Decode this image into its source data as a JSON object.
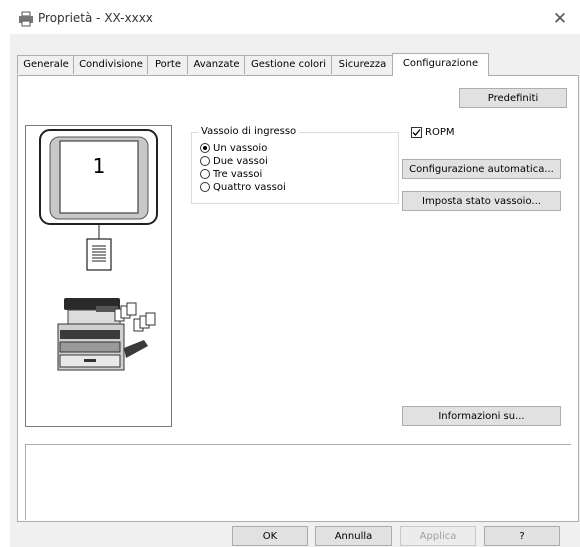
{
  "window": {
    "title": "Proprietà - XX-xxxx"
  },
  "tabs": [
    {
      "label": "Generale"
    },
    {
      "label": "Condivisione"
    },
    {
      "label": "Porte"
    },
    {
      "label": "Avanzate"
    },
    {
      "label": "Gestione colori"
    },
    {
      "label": "Sicurezza"
    },
    {
      "label": "Configurazione",
      "active": true
    }
  ],
  "config": {
    "defaults_label": "Predefiniti",
    "preview": {
      "tray_number": "1"
    },
    "tray_group": {
      "legend": "Vassoio di ingresso",
      "options": [
        {
          "label": "Un vassoio",
          "selected": true
        },
        {
          "label": "Due vassoi",
          "selected": false
        },
        {
          "label": "Tre vassoi",
          "selected": false
        },
        {
          "label": "Quattro vassoi",
          "selected": false
        }
      ]
    },
    "ropm": {
      "label": "ROPM",
      "checked": true
    },
    "auto_config_label": "Configurazione automatica...",
    "tray_status_label": "Imposta stato vassoio...",
    "about_label": "Informazioni su..."
  },
  "footer": {
    "ok_label": "OK",
    "cancel_label": "Annulla",
    "apply_label": "Applica",
    "help_label": "?"
  }
}
